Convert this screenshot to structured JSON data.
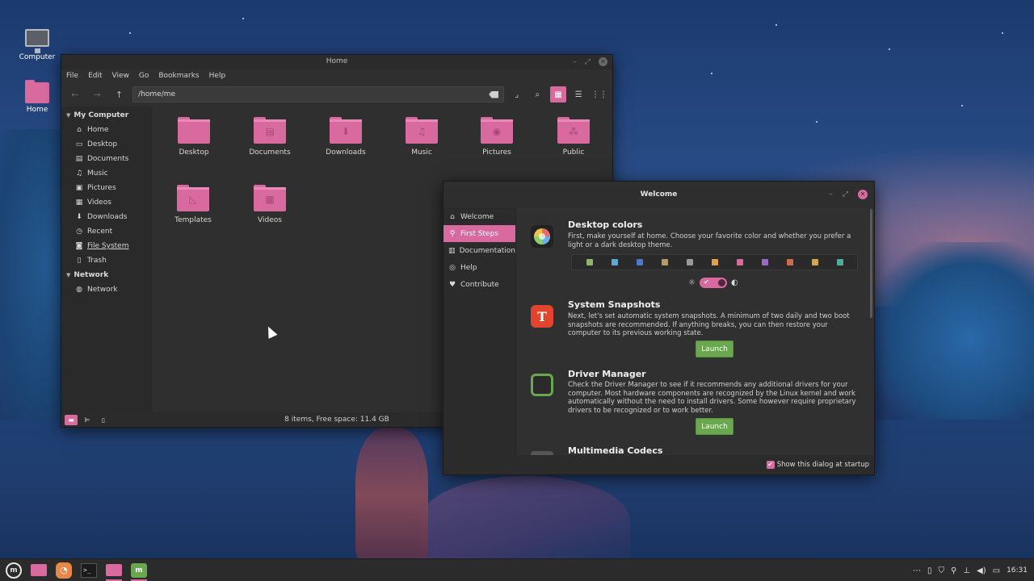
{
  "desktop": {
    "icons": [
      {
        "label": "Computer"
      },
      {
        "label": "Home"
      }
    ]
  },
  "file_manager": {
    "title": "Home",
    "menu": [
      "File",
      "Edit",
      "View",
      "Go",
      "Bookmarks",
      "Help"
    ],
    "location": "/home/me",
    "sidebar": {
      "my_computer_header": "My Computer",
      "my_computer_items": [
        {
          "label": "Home",
          "icon": "home-icon"
        },
        {
          "label": "Desktop",
          "icon": "desktop-icon"
        },
        {
          "label": "Documents",
          "icon": "document-icon"
        },
        {
          "label": "Music",
          "icon": "music-icon"
        },
        {
          "label": "Pictures",
          "icon": "picture-icon"
        },
        {
          "label": "Videos",
          "icon": "video-icon"
        },
        {
          "label": "Downloads",
          "icon": "download-icon"
        },
        {
          "label": "Recent",
          "icon": "recent-icon"
        },
        {
          "label": "File System",
          "icon": "drive-icon"
        },
        {
          "label": "Trash",
          "icon": "trash-icon"
        }
      ],
      "network_header": "Network",
      "network_items": [
        {
          "label": "Network",
          "icon": "network-icon"
        }
      ]
    },
    "folders": [
      {
        "label": "Desktop",
        "glyph": ""
      },
      {
        "label": "Documents",
        "glyph": "▤"
      },
      {
        "label": "Downloads",
        "glyph": "⬇"
      },
      {
        "label": "Music",
        "glyph": "♫"
      },
      {
        "label": "Pictures",
        "glyph": "◉"
      },
      {
        "label": "Public",
        "glyph": "⁂"
      },
      {
        "label": "Templates",
        "glyph": "◺"
      },
      {
        "label": "Videos",
        "glyph": "▦"
      }
    ],
    "status": "8 items, Free space: 11.4 GB"
  },
  "welcome": {
    "title": "Welcome",
    "nav": [
      {
        "label": "Welcome",
        "icon": "home-icon",
        "active": false
      },
      {
        "label": "First Steps",
        "icon": "pin-icon",
        "active": true
      },
      {
        "label": "Documentation",
        "icon": "book-icon",
        "active": false
      },
      {
        "label": "Help",
        "icon": "help-icon",
        "active": false
      },
      {
        "label": "Contribute",
        "icon": "heart-icon",
        "active": false
      }
    ],
    "sections": {
      "desktop_colors": {
        "title": "Desktop colors",
        "desc": "First, make yourself at home. Choose your favorite color and whether you prefer a light or a dark desktop theme."
      },
      "snapshots": {
        "title": "System Snapshots",
        "desc": "Next, let's set automatic system snapshots. A minimum of two daily and two boot snapshots are recommended. If anything breaks, you can then restore your computer to its previous working state.",
        "button": "Launch"
      },
      "drivers": {
        "title": "Driver Manager",
        "desc": "Check the Driver Manager to see if it recommends any additional drivers for your computer. Most hardware components are recognized by the Linux kernel and work automatically without the need to install drivers. Some however require proprietary drivers to be recognized or to work better.",
        "button": "Launch"
      },
      "codecs": {
        "title": "Multimedia Codecs"
      }
    },
    "swatches": [
      "#8fb36a",
      "#5fa8d3",
      "#4f77c9",
      "#b59a6a",
      "#9a9a9a",
      "#e0a04a",
      "#d86aa0",
      "#9a6ac9",
      "#d06a4a",
      "#d4a84a",
      "#4fae9a"
    ],
    "startup_label": "Show this dialog at startup"
  },
  "taskbar": {
    "clock": "16:31",
    "apps": [
      "menu",
      "files",
      "firefox",
      "terminal",
      "files-running",
      "welcome-running"
    ]
  },
  "colors": {
    "accent": "#d86aa0",
    "launch_green": "#6aa84f"
  }
}
